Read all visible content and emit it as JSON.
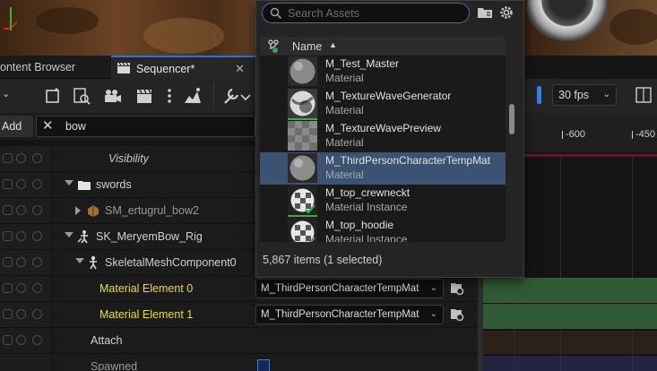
{
  "tabs": {
    "content_browser": "ontent Browser",
    "sequencer": "Sequencer*",
    "close": "✕"
  },
  "toolbar": {
    "fps": "30 fps",
    "icons": [
      "save-icon",
      "browse-icon",
      "camera-icon",
      "clapper-icon",
      "more-icon",
      "wrench-icon",
      "chart-icon"
    ]
  },
  "track_filter": {
    "add_label": "Add",
    "clear_label": "✕",
    "search_value": "bow"
  },
  "timeline": {
    "ticks": [
      "-600",
      "-450"
    ]
  },
  "outliner": {
    "rows": [
      {
        "label": "Visibility"
      },
      {
        "label": "swords"
      },
      {
        "label": "SM_ertugrul_bow2"
      },
      {
        "label": "SK_MeryemBow_Rig"
      },
      {
        "label": "SkeletalMeshComponent0"
      },
      {
        "label": "Material Element 0",
        "value": "M_ThirdPersonCharacterTempMat"
      },
      {
        "label": "Material Element 1",
        "value": "M_ThirdPersonCharacterTempMat"
      },
      {
        "label": "Attach"
      },
      {
        "label": "Spawned"
      }
    ]
  },
  "picker": {
    "search_placeholder": "Search Assets",
    "column_name": "Name",
    "sort_indicator": "▲",
    "assets": [
      {
        "name": "M_Test_Master",
        "type": "Material",
        "selected": false
      },
      {
        "name": "M_TextureWaveGenerator",
        "type": "Material",
        "selected": false
      },
      {
        "name": "M_TextureWavePreview",
        "type": "Material",
        "selected": false
      },
      {
        "name": "M_ThirdPersonCharacterTempMat",
        "type": "Material",
        "selected": true
      },
      {
        "name": "M_top_crewneckt",
        "type": "Material Instance",
        "selected": false
      },
      {
        "name": "M_top_hoodie",
        "type": "Material Instance",
        "selected": false
      }
    ],
    "status": "5,867 items (1 selected)"
  },
  "colors": {
    "accent_blue": "#2f80ed",
    "selection": "#3b5272",
    "track_green": "#2f5a33",
    "label_yellow": "#e8dd3a"
  }
}
